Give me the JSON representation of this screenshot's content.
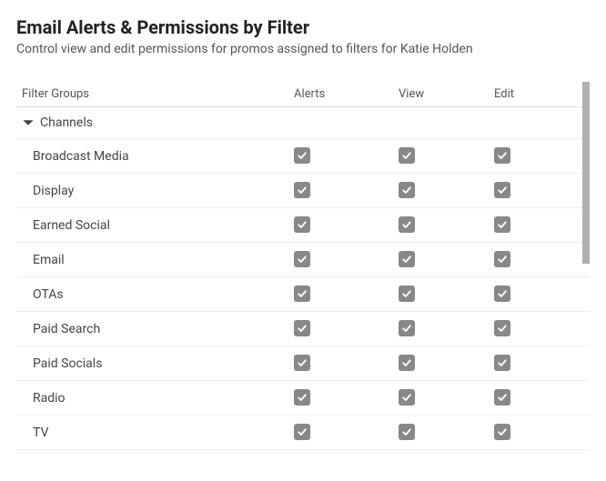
{
  "header": {
    "title": "Email Alerts & Permissions by Filter",
    "subtitle": "Control view and edit permissions for promos assigned to filters for Katie Holden"
  },
  "columns": {
    "name": "Filter Groups",
    "alerts": "Alerts",
    "view": "View",
    "edit": "Edit"
  },
  "group": {
    "label": "Channels",
    "expanded": true
  },
  "rows": [
    {
      "label": "Broadcast Media",
      "alerts": true,
      "view": true,
      "edit": true
    },
    {
      "label": "Display",
      "alerts": true,
      "view": true,
      "edit": true
    },
    {
      "label": "Earned Social",
      "alerts": true,
      "view": true,
      "edit": true
    },
    {
      "label": "Email",
      "alerts": true,
      "view": true,
      "edit": true
    },
    {
      "label": "OTAs",
      "alerts": true,
      "view": true,
      "edit": true
    },
    {
      "label": "Paid Search",
      "alerts": true,
      "view": true,
      "edit": true
    },
    {
      "label": "Paid Socials",
      "alerts": true,
      "view": true,
      "edit": true
    },
    {
      "label": "Radio",
      "alerts": true,
      "view": true,
      "edit": true
    },
    {
      "label": "TV",
      "alerts": true,
      "view": true,
      "edit": true
    }
  ]
}
